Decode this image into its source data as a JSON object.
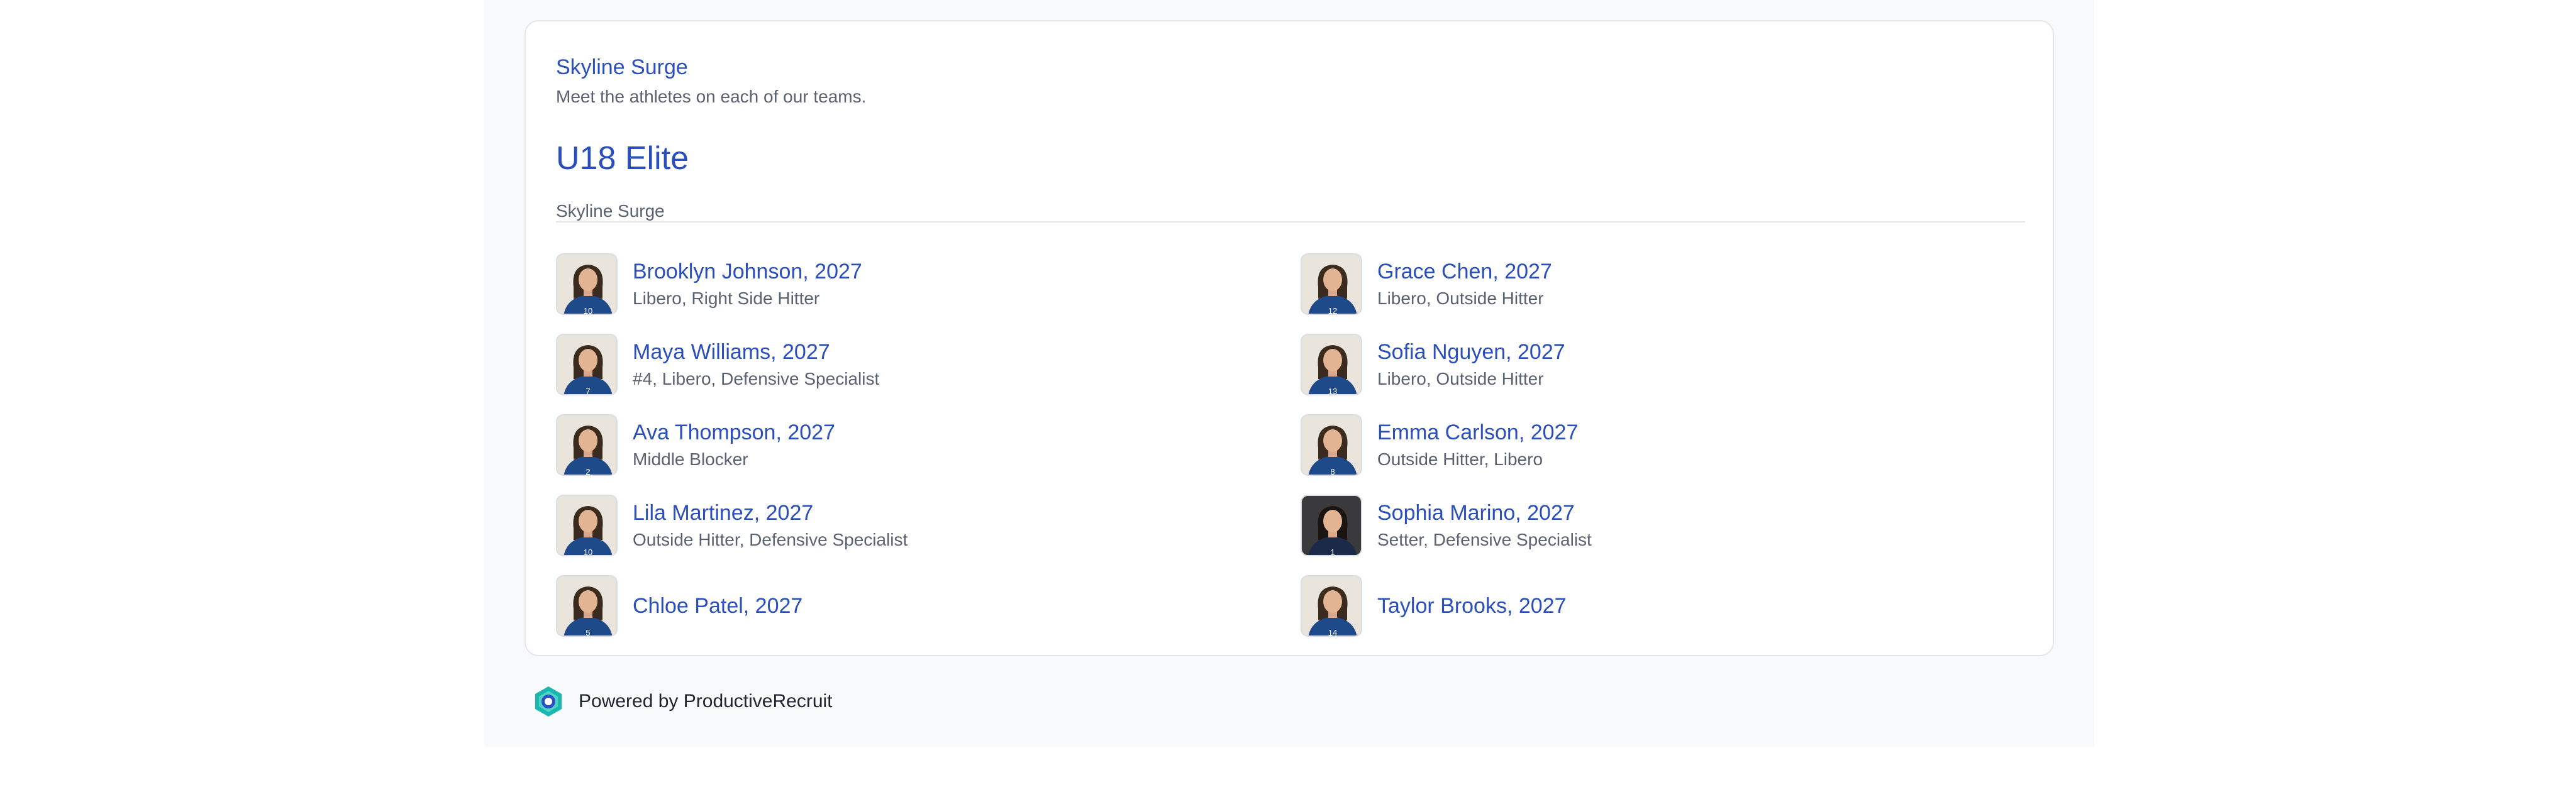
{
  "organization": {
    "name": "Skyline Surge",
    "tagline": "Meet the athletes on each of our teams."
  },
  "team": {
    "name": "U18 Elite",
    "organization": "Skyline Surge"
  },
  "athletes": [
    {
      "name": "Brooklyn Johnson, 2027",
      "positions": "Libero, Right Side Hitter",
      "jersey": "10",
      "photo_bg": "light"
    },
    {
      "name": "Grace Chen, 2027",
      "positions": "Libero, Outside Hitter",
      "jersey": "12",
      "photo_bg": "light"
    },
    {
      "name": "Maya Williams, 2027",
      "positions": "#4, Libero, Defensive Specialist",
      "jersey": "7",
      "photo_bg": "light"
    },
    {
      "name": "Sofia Nguyen, 2027",
      "positions": "Libero, Outside Hitter",
      "jersey": "13",
      "photo_bg": "light"
    },
    {
      "name": "Ava Thompson, 2027",
      "positions": "Middle Blocker",
      "jersey": "2",
      "photo_bg": "light"
    },
    {
      "name": "Emma Carlson, 2027",
      "positions": "Outside Hitter, Libero",
      "jersey": "8",
      "photo_bg": "light"
    },
    {
      "name": "Lila Martinez, 2027",
      "positions": "Outside Hitter, Defensive Specialist",
      "jersey": "10",
      "photo_bg": "light"
    },
    {
      "name": "Sophia Marino, 2027",
      "positions": "Setter, Defensive Specialist",
      "jersey": "1",
      "photo_bg": "dark"
    },
    {
      "name": "Chloe Patel, 2027",
      "positions": "",
      "jersey": "5",
      "photo_bg": "light"
    },
    {
      "name": "Taylor Brooks, 2027",
      "positions": "",
      "jersey": "14",
      "photo_bg": "light"
    }
  ],
  "footer": {
    "powered_by": "Powered by ProductiveRecruit",
    "logo_icon": "productiverecruit-logo-icon"
  },
  "colors": {
    "link": "#2a4ebd",
    "muted": "#5a6170",
    "jersey": "#1f4a8a",
    "logo_teal": "#19b7b0",
    "logo_blue": "#2a4ebd"
  }
}
